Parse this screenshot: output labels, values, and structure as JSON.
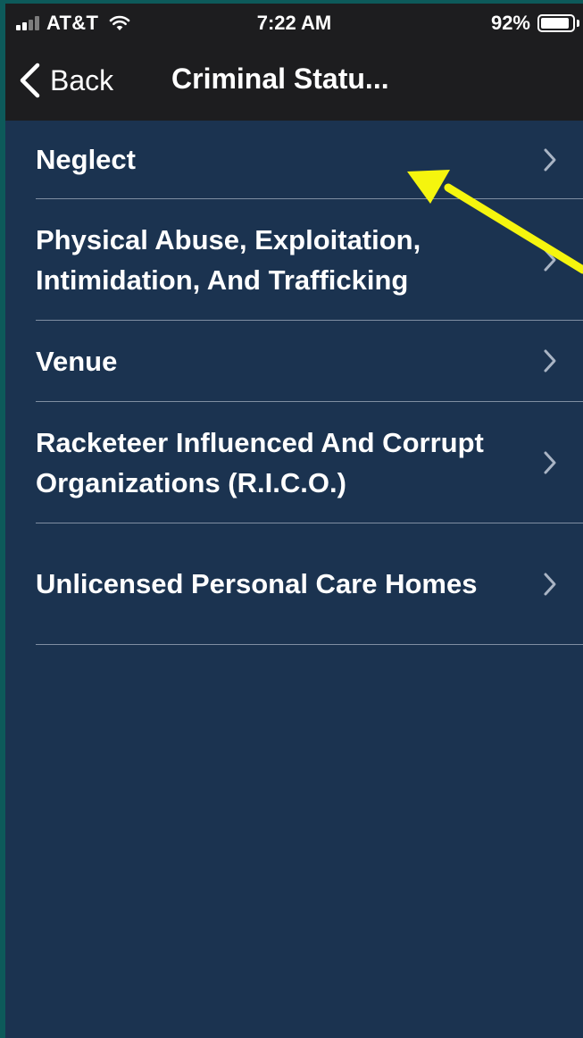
{
  "status_bar": {
    "carrier": "AT&T",
    "time": "7:22 AM",
    "battery_percent": "92%",
    "battery_level": 0.92,
    "signal_bars": 4,
    "signal_bars_strong": 2
  },
  "nav": {
    "back_label": "Back",
    "title": "Criminal Statu..."
  },
  "list": {
    "items": [
      {
        "label": "Neglect"
      },
      {
        "label": "Physical Abuse, Exploitation, Intimidation, And Trafficking"
      },
      {
        "label": "Venue"
      },
      {
        "label": "Racketeer Influenced And Corrupt Organizations (R.I.C.O.)"
      },
      {
        "label": "Unlicensed Personal Care Homes"
      }
    ]
  },
  "colors": {
    "background": "#1b3350",
    "bars": "#1d1d1f",
    "separator": "#7f8ea2",
    "text": "#ffffff",
    "chevron": "#a9b4c4",
    "annotation_arrow": "#f5f50e",
    "frame": "#0d5a5a"
  },
  "icons": {
    "back": "chevron-left-icon",
    "row": "chevron-right-icon",
    "wifi": "wifi-icon",
    "signal": "signal-icon",
    "battery": "battery-icon",
    "annotation": "arrow-annotation"
  }
}
